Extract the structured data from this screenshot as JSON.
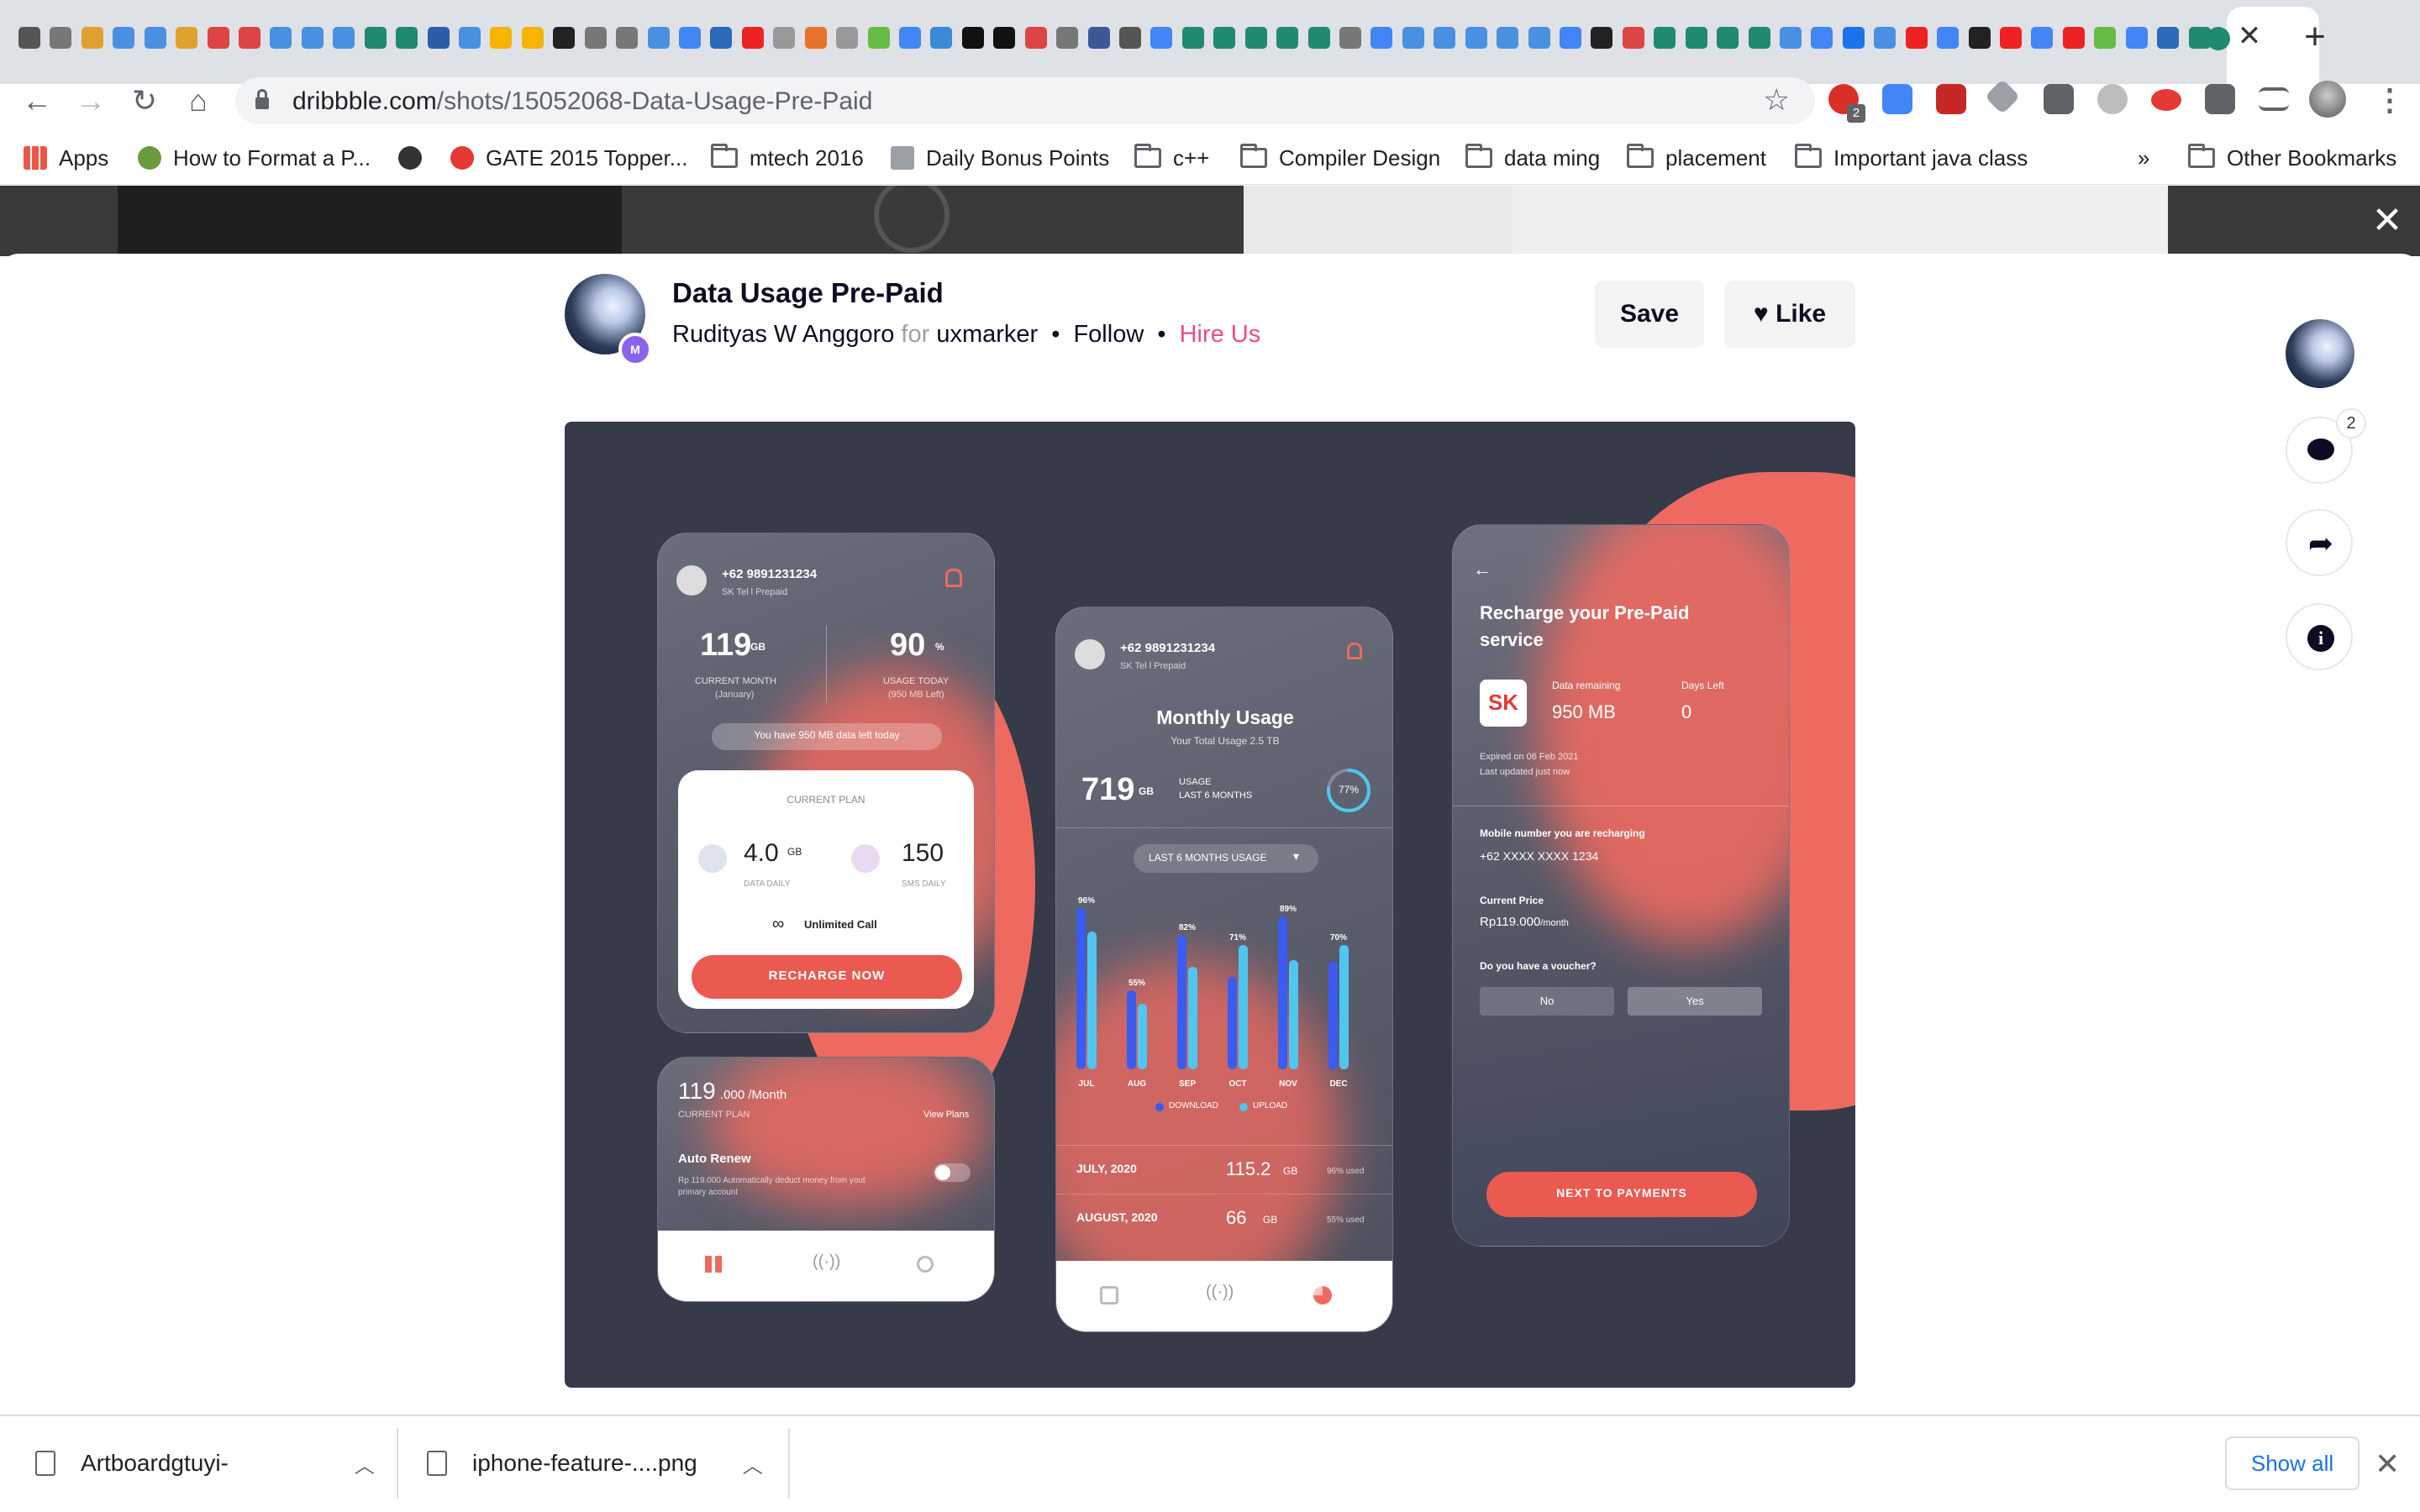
{
  "browser": {
    "url_domain": "dribbble.com",
    "url_path": "/shots/15052068-Data-Usage-Pre-Paid",
    "new_tab": "+",
    "close_tab": "✕",
    "extension_badge": "2",
    "tab_icon_colors": [
      "#555",
      "#777",
      "#e0a030",
      "#4a90e2",
      "#4a90e2",
      "#e0a030",
      "#d44",
      "#d44",
      "#4a90e2",
      "#4a90e2",
      "#4a90e2",
      "#1f8a70",
      "#1f8a70",
      "#2a5fa8",
      "#4a90e2",
      "#f5b400",
      "#f5b400",
      "#222",
      "#777",
      "#777",
      "#4a90e2",
      "#4285f4",
      "#2a6ab8",
      "#e22",
      "#999",
      "#e8712d",
      "#999",
      "#6b4",
      "#4285f4",
      "#3a8ad6",
      "#111",
      "#111",
      "#d44",
      "#777",
      "#3b5998",
      "#555",
      "#4285f4",
      "#1f8a70",
      "#1f8a70",
      "#1f8a70",
      "#1f8a70",
      "#1f8a70",
      "#777",
      "#4285f4",
      "#4a90e2",
      "#4a90e2",
      "#4a90e2",
      "#4a90e2",
      "#4a90e2",
      "#4285f4",
      "#222",
      "#d44",
      "#1f8a70",
      "#1f8a70",
      "#1f8a70",
      "#1f8a70",
      "#4a90e2",
      "#4285f4",
      "#1a73e8",
      "#4a90e2",
      "#e22",
      "#4285f4",
      "#222",
      "#e22",
      "#4285f4",
      "#e22",
      "#6b4",
      "#4285f4",
      "#2a6ab8",
      "#1f8a70"
    ]
  },
  "bookmarks": {
    "apps": "Apps",
    "items": [
      "How to Format a P...",
      "GATE 2015 Topper...",
      "mtech 2016",
      "Daily Bonus Points",
      "c++",
      "Compiler Design",
      "data ming",
      "placement",
      "Important java class"
    ],
    "overflow": "»",
    "other": "Other Bookmarks"
  },
  "shot": {
    "title": "Data Usage Pre-Paid",
    "author": "Rudityas W Anggoro",
    "for_word": "for",
    "team": "uxmarker",
    "dot": "•",
    "follow": "Follow",
    "hire": "Hire Us",
    "save": "Save",
    "like": "Like",
    "badge_letter": "M",
    "comment_count": "2",
    "close": "✕"
  },
  "design": {
    "phone1": {
      "number": "+62 9891231234",
      "carrier": "SK Tel l Prepaid",
      "gb_value": "119",
      "gb_unit": "GB",
      "gb_label": "CURRENT MONTH",
      "gb_sub": "(January)",
      "pct_value": "90",
      "pct_unit": "%",
      "pct_label": "USAGE TODAY",
      "pct_sub": "(950 MB Left)",
      "pill": "You have 950 MB data left today",
      "plan_label": "CURRENT PLAN",
      "data_value": "4.0",
      "data_unit": "GB",
      "data_label": "DATA DAILY",
      "sms_value": "150",
      "sms_label": "SMS DAILY",
      "unlimited": "Unlimited Call",
      "recharge": "RECHARGE NOW"
    },
    "phone1b": {
      "price": "119",
      "price_suffix": ".000 /Month",
      "plan_label": "CURRENT PLAN",
      "view_plans": "View Plans",
      "auto_renew": "Auto Renew",
      "auto_desc": "Rp 119.000 Automatically deduct money from yout primary account"
    },
    "phone2": {
      "number": "+62 9891231234",
      "carrier": "SK Tel l Prepaid",
      "title": "Monthly Usage",
      "subtitle": "Your Total Usage 2.5 TB",
      "usage_value": "719",
      "usage_unit": "GB",
      "usage_label": "USAGE",
      "usage_label2": "LAST 6 MONTHS",
      "ring": "77%",
      "ring_fraction": 0.77,
      "dropdown": "LAST 6 MONTHS USAGE",
      "legend_download": "DOWNLOAD",
      "legend_upload": "UPLOAD",
      "row1_month": "JULY, 2020",
      "row1_value": "115.2",
      "row1_unit": "GB",
      "row1_used": "96% used",
      "row2_month": "AUGUST, 2020",
      "row2_value": "66",
      "row2_unit": "GB",
      "row2_used": "55% used"
    },
    "phone3": {
      "back": "←",
      "title1": "Recharge your Pre-Paid",
      "title2": "service",
      "logo": "SK",
      "remaining_label": "Data remaining",
      "remaining_value": "950 MB",
      "days_label": "Days Left",
      "days_value": "0",
      "expired": "Expired on 06 Feb 2021",
      "updated": "Last updated just now",
      "mobile_label": "Mobile number you are recharging",
      "mobile_value": "+62 XXXX XXXX 1234",
      "price_label": "Current Price",
      "price_value": "Rp119.000",
      "price_unit": "/month",
      "voucher_label": "Do you have a voucher?",
      "no": "No",
      "yes": "Yes",
      "next": "NEXT TO PAYMENTS"
    },
    "colors": {
      "coral": "#ee6a60",
      "download": "#3a5cf0",
      "upload": "#4fc6f0",
      "bg": "#363a49"
    }
  },
  "chart_data": {
    "type": "bar",
    "categories": [
      "JUL",
      "AUG",
      "SEP",
      "OCT",
      "NOV",
      "DEC"
    ],
    "labels": [
      "96%",
      "55%",
      "82%",
      "71%",
      "89%",
      "70%"
    ],
    "series": [
      {
        "name": "DOWNLOAD",
        "values": [
          96,
          47,
          80,
          55,
          91,
          64
        ]
      },
      {
        "name": "UPLOAD",
        "values": [
          82,
          39,
          61,
          74,
          65,
          74
        ]
      }
    ],
    "ylim": [
      0,
      100
    ],
    "legend": "bottom"
  },
  "downloads": {
    "items": [
      "Artboardgtuyi-",
      "iphone-feature-....png"
    ],
    "show_all": "Show all",
    "close": "✕"
  }
}
